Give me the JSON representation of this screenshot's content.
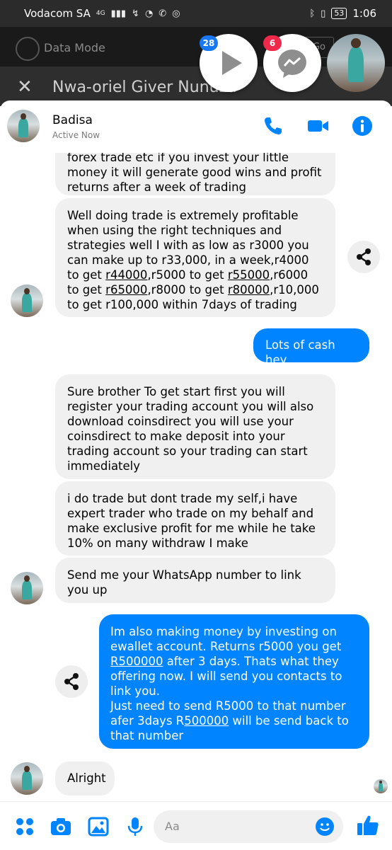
{
  "status_bar": {
    "carrier": "Vodacom SA",
    "network": "4G",
    "battery": "53",
    "time": "1:06"
  },
  "background_app": {
    "mode_label": "Data Mode",
    "go_label": "Go",
    "conversation_title": "Nwa-oriel Giver Nunuza"
  },
  "chat_heads": {
    "video_badge": "28",
    "messenger_badge": "6"
  },
  "header": {
    "contact_name": "Badisa",
    "status": "Active Now"
  },
  "messages": {
    "m1": "forex trade etc if you invest your little money it will generate good wins and profit returns after a week of trading",
    "m2a": "Well doing trade is extremely profitable when using the right techniques and strategies well I with as low as r3000 you can make up to r33,000, in a week,r4000 to get ",
    "m2_44": "r44000",
    "m2b": ",r5000 to get ",
    "m2_55": "r55000",
    "m2c": ",r6000 to get ",
    "m2_65": "r65000",
    "m2d": ",r8000 to get ",
    "m2_80": "r80000",
    "m2e": ",r10,000 to get r100,000 within 7days of trading",
    "m3": "Lots of cash hey",
    "m4": "Sure brother  To get start first you will register your trading account you will also download coinsdirect you will use your coinsdirect  to make deposit into your trading account so your trading can start immediately",
    "m5": "i do trade but dont trade my self,i have expert trader who  trade on my behalf and make exclusive profit for me while he take 10% on many withdraw I make",
    "m6": "Send me your WhatsApp number to link you up",
    "m7a": "Im also making money by investing on ewallet account. Returns r5000 you get ",
    "m7_r1": "R500000",
    "m7b": " after 3 days. Thats what they offering now. I will send you contacts to link you.",
    "m7c": "Just need to send R5000 to that number afer 3days R",
    "m7_r2": "500000",
    "m7d": " will be send back to that number",
    "m8": "Alright"
  },
  "composer": {
    "placeholder": "Aa"
  },
  "colors": {
    "accent": "#0084ff",
    "incoming_bubble": "#f0f0f0",
    "badge_red": "#f02849",
    "badge_blue": "#1877f2"
  }
}
